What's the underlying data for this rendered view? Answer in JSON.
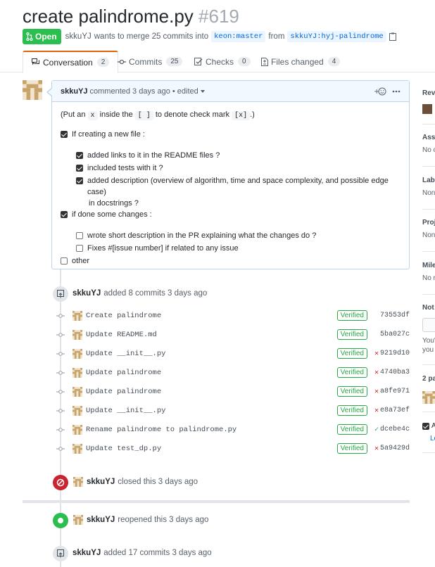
{
  "pr": {
    "title": "create palindrome.py",
    "number": "#619",
    "state": "Open",
    "author": "skkuYJ",
    "merge_text": "wants to merge 25 commits into",
    "base_branch": "keon:master",
    "from_text": "from",
    "head_branch": "skkuYJ:hyj-palindrome"
  },
  "tabs": [
    {
      "label": "Conversation",
      "count": "2",
      "icon": "comment-discussion-icon"
    },
    {
      "label": "Commits",
      "count": "25",
      "icon": "git-commit-icon"
    },
    {
      "label": "Checks",
      "count": "0",
      "icon": "checklist-icon"
    },
    {
      "label": "Files changed",
      "count": "4",
      "icon": "file-diff-icon"
    }
  ],
  "comment": {
    "author": "skkuYJ",
    "meta": "commented 3 days ago",
    "edited": "• edited",
    "intro_a": "(Put an",
    "intro_code1": "x",
    "intro_b": "inside the",
    "intro_code2": "[ ]",
    "intro_c": "to denote check mark",
    "intro_code3": "[x]",
    "intro_d": ".)",
    "tasks": [
      {
        "label": "If creating a new file :",
        "checked": true
      },
      {
        "label": "added links to it in the README files ?",
        "checked": true
      },
      {
        "label": "included tests with it ?",
        "checked": true
      },
      {
        "label": "added description (overview of algorithm, time and space complexity, and possible edge case)",
        "label2": "in docstrings ?",
        "checked": true
      },
      {
        "label": "if done some changes :",
        "checked": true
      },
      {
        "label": "wrote short description in the PR explaining what the changes do ?",
        "checked": false
      },
      {
        "label": "Fixes #[issue number] if related to any issue",
        "checked": false
      },
      {
        "label": "other",
        "checked": false
      }
    ]
  },
  "timeline": {
    "commits_event": {
      "author": "skkuYJ",
      "text": "added 8 commits 3 days ago"
    },
    "commits": [
      {
        "message": "Create palindrome",
        "verified": "Verified",
        "sha": "73553df",
        "status": ""
      },
      {
        "message": "Update README.md",
        "verified": "Verified",
        "sha": "5ba027c",
        "status": ""
      },
      {
        "message": "Update __init__.py",
        "verified": "Verified",
        "sha": "9219d10",
        "status": "fail"
      },
      {
        "message": "Update palindrome",
        "verified": "Verified",
        "sha": "4740ba3",
        "status": "fail"
      },
      {
        "message": "Update palindrome",
        "verified": "Verified",
        "sha": "a8fe971",
        "status": "fail"
      },
      {
        "message": "Update __init__.py",
        "verified": "Verified",
        "sha": "e8a73ef",
        "status": "fail"
      },
      {
        "message": "Rename palindrome to palindrome.py",
        "verified": "Verified",
        "sha": "dcebe4c",
        "status": "ok"
      },
      {
        "message": "Update test_dp.py",
        "verified": "Verified",
        "sha": "5a9429d",
        "status": "fail"
      }
    ],
    "closed_event": {
      "author": "skkuYJ",
      "text": "closed this 3 days ago"
    },
    "reopened_event": {
      "author": "skkuYJ",
      "text": "reopened this 3 days ago"
    },
    "commits_event2": {
      "author": "skkuYJ",
      "text": "added 17 commits 3 days ago"
    }
  },
  "sidebar": {
    "reviewers": "Revi",
    "assignees": "Assi",
    "assignees_val": "No o",
    "labels": "Labe",
    "labels_val": "Non",
    "projects": "Proj",
    "projects_val": "Non",
    "milestone": "Mile",
    "milestone_val": "No m",
    "notifications": "Not",
    "notif_text1": "You'",
    "notif_text2": "you",
    "participants": "2 pa",
    "allow_edits": "A",
    "learn": "Le"
  },
  "colors": {
    "open_green": "#2cbe4e",
    "closed_red": "#cb2431",
    "link_blue": "#0366d6",
    "tab_accent": "#e36209"
  }
}
